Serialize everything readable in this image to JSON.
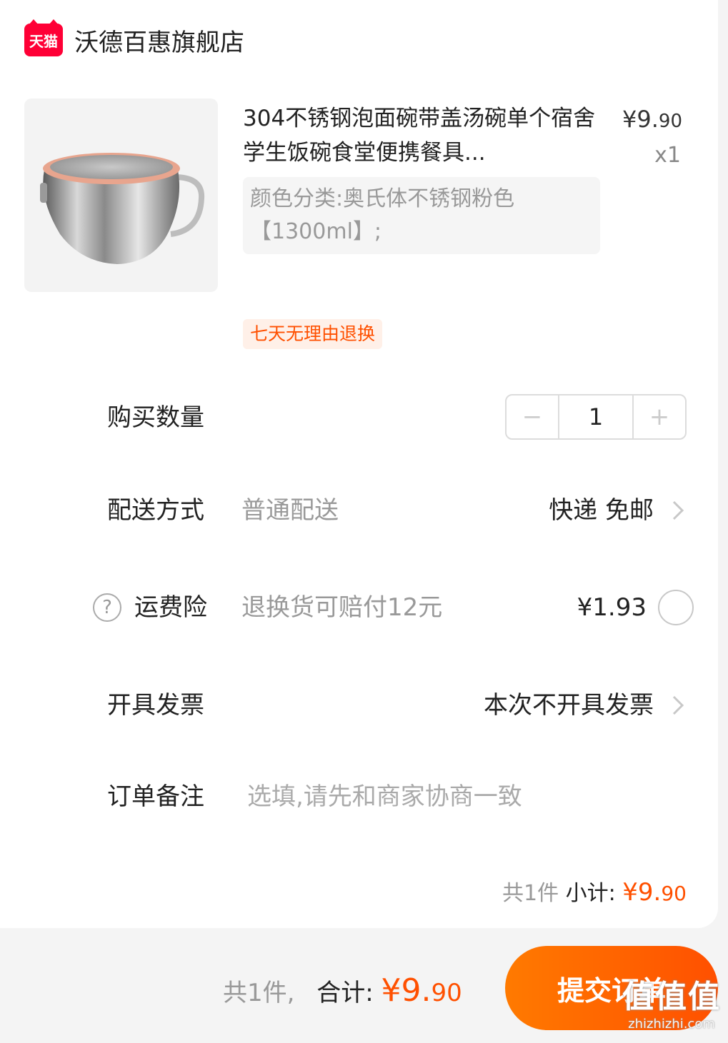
{
  "store": {
    "badge": "天猫",
    "name": "沃德百惠旗舰店"
  },
  "product": {
    "title": "304不锈钢泡面碗带盖汤碗单个宿舍学生饭碗食堂便携餐具...",
    "price_main": "¥9.",
    "price_decimal": "90",
    "quantity": "x1",
    "sku": "颜色分类:奥氏体不锈钢粉色【1300ml】;",
    "tag": "七天无理由退换"
  },
  "quantity_row": {
    "label": "购买数量",
    "minus": "−",
    "value": "1",
    "plus": "+"
  },
  "delivery": {
    "label": "配送方式",
    "method": "普通配送",
    "value": "快递 免邮"
  },
  "insurance": {
    "help": "?",
    "label": "运费险",
    "desc": "退换货可赔付12元",
    "price": "¥1.93"
  },
  "invoice": {
    "label": "开具发票",
    "value": "本次不开具发票"
  },
  "remark": {
    "label": "订单备注",
    "placeholder": "选填,请先和商家协商一致"
  },
  "subtotal": {
    "count": "共1件",
    "label": "小计:",
    "amount_main": "¥9.",
    "amount_decimal": "90"
  },
  "footer": {
    "count": "共1件,",
    "total_label": "合计:",
    "amount_main": "¥9.",
    "amount_decimal": "90",
    "submit": "提交订单"
  },
  "watermark": {
    "big": "值值值",
    "small": "zhizhizhi.com"
  },
  "colors": {
    "accent": "#ff5000",
    "tmall": "#ff0036"
  },
  "icons": {
    "chevron": "chevron-right-icon",
    "help": "question-circle-icon",
    "radio": "radio-unchecked-icon"
  }
}
